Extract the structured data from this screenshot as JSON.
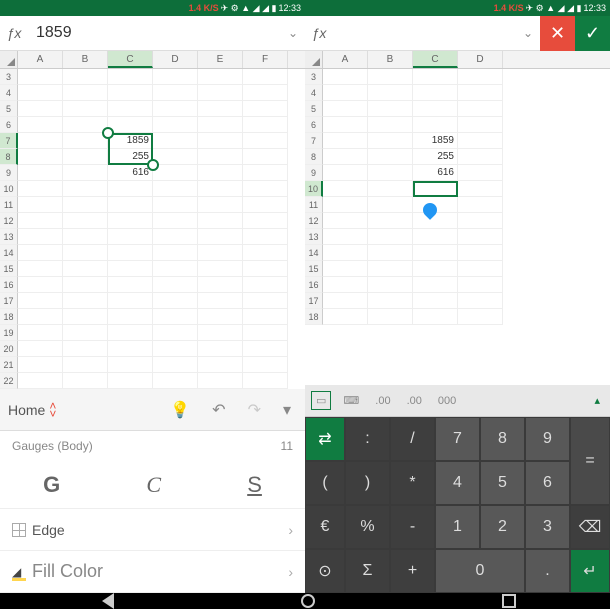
{
  "status": {
    "speed": "1.4 K/S",
    "time": "12:33"
  },
  "left": {
    "fx_value": "1859",
    "columns": [
      "A",
      "B",
      "C",
      "D",
      "E",
      "F"
    ],
    "rows": [
      "3",
      "4",
      "5",
      "6",
      "7",
      "8",
      "9",
      "10",
      "11",
      "12",
      "13",
      "14",
      "15",
      "16",
      "17",
      "18",
      "19",
      "20",
      "21",
      "22"
    ],
    "sel_col": "C",
    "sel_rows": [
      "7",
      "8"
    ],
    "cells": {
      "C7": "1859",
      "C8": "255",
      "C9": "616"
    },
    "toolbar": {
      "home": "Home",
      "gauges": "Gauges (Body)",
      "gauges_val": "11",
      "style_b": "G",
      "style_i": "C",
      "style_u": "S",
      "edge": "Edge",
      "fill": "Fill Color"
    }
  },
  "right": {
    "fx_value": "",
    "columns": [
      "A",
      "B",
      "C",
      "D"
    ],
    "rows": [
      "3",
      "4",
      "5",
      "6",
      "7",
      "8",
      "9",
      "10",
      "11",
      "12",
      "13",
      "14",
      "15",
      "16",
      "17",
      "18"
    ],
    "sel_col": "C",
    "sel_row": "10",
    "cells": {
      "C7": "1859",
      "C8": "255",
      "C9": "616"
    },
    "keypad_top": {
      "dec1": ".00",
      "dec2": ".00",
      "triple": "000"
    },
    "keys": {
      "tab": "⇄",
      "colon": ":",
      "slash": "/",
      "n7": "7",
      "n8": "8",
      "n9": "9",
      "eq": "=",
      "lp": "(",
      "rp": ")",
      "star": "*",
      "n4": "4",
      "n5": "5",
      "n6": "6",
      "eur": "€",
      "pct": "%",
      "minus": "-",
      "n1": "1",
      "n2": "2",
      "n3": "3",
      "bsp": "⌫",
      "rarr": "⊙",
      "sigma": "Σ",
      "plus": "+",
      "n0": "0",
      "dot": ".",
      "enter": "↵"
    }
  }
}
